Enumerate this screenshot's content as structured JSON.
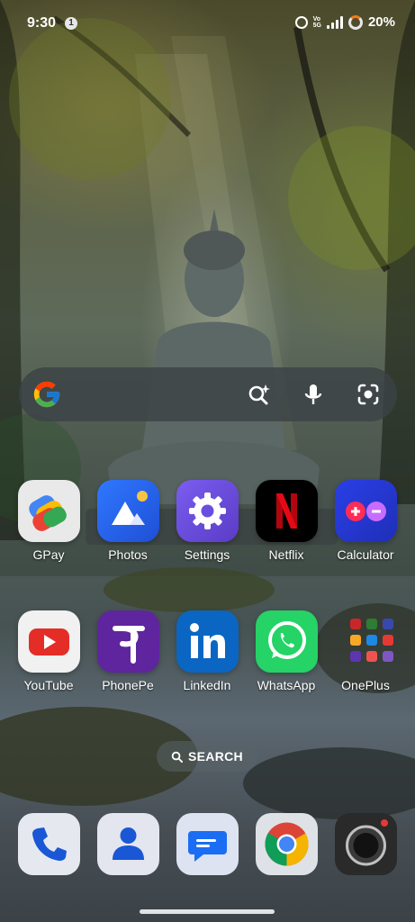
{
  "status_bar": {
    "time": "9:30",
    "notification_count": "1",
    "network_top": "Vo",
    "network_bottom": "5G",
    "network_type": "5G",
    "battery": "20%"
  },
  "search_bar": {
    "logo": "google-g-icon",
    "actions": [
      "ai-mode-icon",
      "microphone-icon",
      "lens-camera-icon"
    ]
  },
  "apps": {
    "row1": [
      {
        "label": "GPay",
        "icon": "gpay-icon"
      },
      {
        "label": "Photos",
        "icon": "photos-icon"
      },
      {
        "label": "Settings",
        "icon": "settings-gear-icon"
      },
      {
        "label": "Netflix",
        "icon": "netflix-icon"
      },
      {
        "label": "Calculator",
        "icon": "calculator-icon"
      }
    ],
    "row2": [
      {
        "label": "YouTube",
        "icon": "youtube-icon"
      },
      {
        "label": "PhonePe",
        "icon": "phonepe-icon"
      },
      {
        "label": "LinkedIn",
        "icon": "linkedin-icon"
      },
      {
        "label": "WhatsApp",
        "icon": "whatsapp-icon"
      },
      {
        "label": "OnePlus",
        "icon": "folder-icon"
      }
    ]
  },
  "app_drawer_search": {
    "label": "SEARCH",
    "icon": "search-icon"
  },
  "dock": [
    "phone-icon",
    "contacts-icon",
    "messages-icon",
    "chrome-icon",
    "camera-icon"
  ],
  "colors": {
    "youtube_red": "#e52d27",
    "netflix_red": "#e50914",
    "linkedin_blue": "#0a66c2",
    "whatsapp_green": "#25d366",
    "phonepe_purple": "#5f259f",
    "settings_purple": "#6c4fd8",
    "battery_orange": "#f07b22"
  }
}
